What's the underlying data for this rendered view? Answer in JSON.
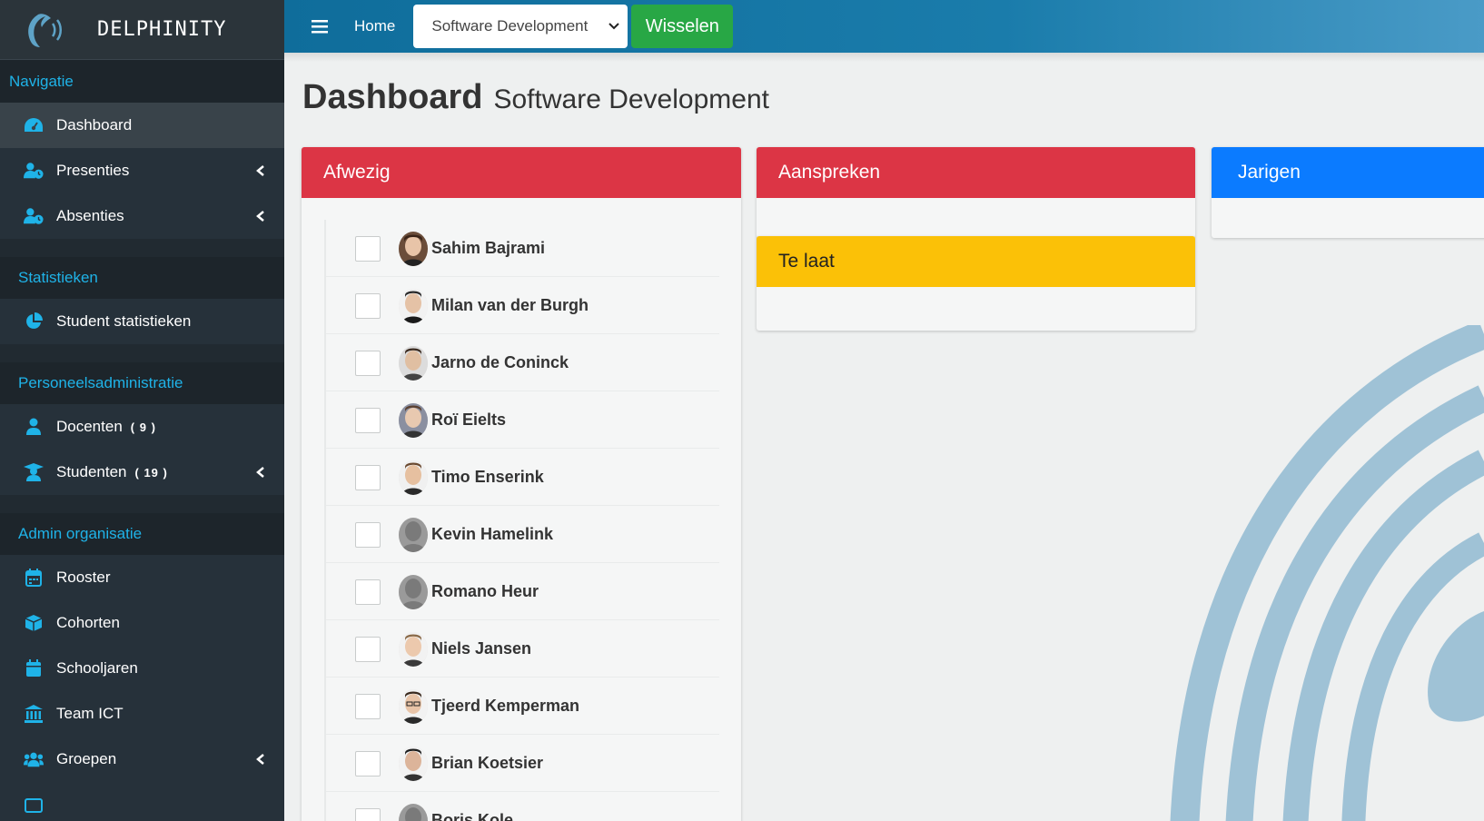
{
  "brand": {
    "name": "DELPHINITY",
    "logo_icon": "dolphin-logo-icon"
  },
  "colors": {
    "sidebar": "#212a31",
    "accent": "#1fb3e8",
    "topbar": "#0f6d9b",
    "success": "#28a745",
    "danger": "#dc3545",
    "primary": "#0b7bff",
    "warning": "#fbc107"
  },
  "sidebar": {
    "sections": [
      {
        "header": "Navigatie",
        "items": [
          {
            "label": "Dashboard",
            "icon": "dashboard-icon",
            "active": true
          },
          {
            "label": "Presenties",
            "icon": "user-clock-icon",
            "chevron": true
          },
          {
            "label": "Absenties",
            "icon": "user-clock-icon",
            "chevron": true
          }
        ]
      },
      {
        "header": "Statistieken",
        "items": [
          {
            "label": "Student statistieken",
            "icon": "pie-chart-icon"
          }
        ]
      },
      {
        "header": "Personeelsadministratie",
        "items": [
          {
            "label": "Docenten",
            "badge": "( 9 )",
            "icon": "user-icon"
          },
          {
            "label": "Studenten",
            "badge": "( 19 )",
            "icon": "graduate-icon",
            "chevron": true
          }
        ]
      },
      {
        "header": "Admin organisatie",
        "items": [
          {
            "label": "Rooster",
            "icon": "calendar-icon"
          },
          {
            "label": "Cohorten",
            "icon": "cube-icon"
          },
          {
            "label": "Schooljaren",
            "icon": "calendar-filled-icon"
          },
          {
            "label": "Team ICT",
            "icon": "building-columns-icon"
          },
          {
            "label": "Groepen",
            "icon": "users-icon",
            "chevron": true
          }
        ]
      }
    ]
  },
  "topbar": {
    "home_label": "Home",
    "select_value": "Software Development",
    "switch_label": "Wisselen"
  },
  "page": {
    "title": "Dashboard",
    "subtitle": "Software Development"
  },
  "cards": {
    "absent": {
      "title": "Afwezig"
    },
    "address": {
      "title": "Aanspreken"
    },
    "late": {
      "title": "Te laat"
    },
    "birthdays": {
      "title": "Jarigen"
    }
  },
  "absent_students": [
    {
      "name": "Sahim Bajrami"
    },
    {
      "name": "Milan van der Burgh"
    },
    {
      "name": "Jarno de Coninck"
    },
    {
      "name": "Roï Eielts"
    },
    {
      "name": "Timo Enserink"
    },
    {
      "name": "Kevin Hamelink"
    },
    {
      "name": "Romano Heur"
    },
    {
      "name": "Niels Jansen"
    },
    {
      "name": "Tjeerd Kemperman"
    },
    {
      "name": "Brian Koetsier"
    },
    {
      "name": "Boris Kole"
    }
  ]
}
